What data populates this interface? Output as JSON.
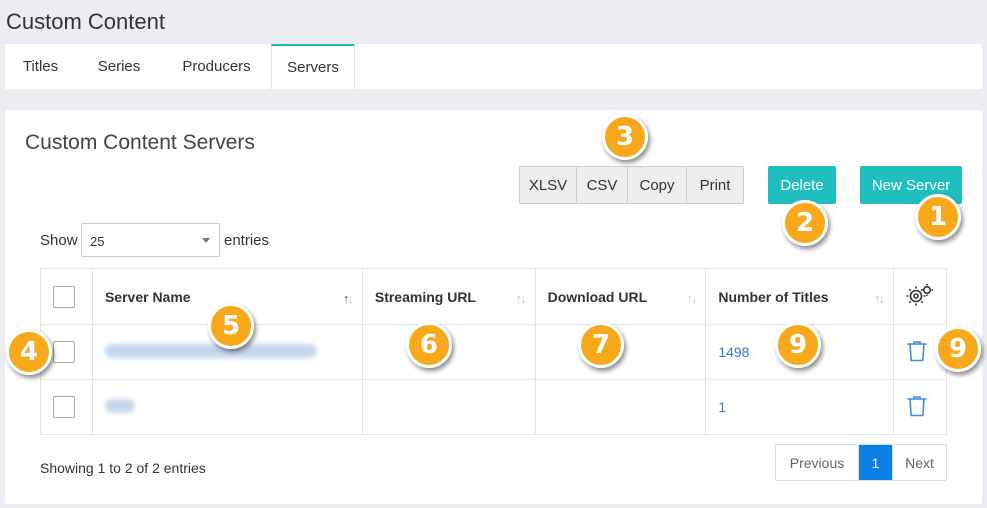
{
  "page_title": "Custom Content",
  "tabs": [
    {
      "label": "Titles"
    },
    {
      "label": "Series"
    },
    {
      "label": "Producers"
    },
    {
      "label": "Servers"
    }
  ],
  "panel": {
    "title": "Custom Content Servers",
    "export_buttons": {
      "xlsv": "XLSV",
      "csv": "CSV",
      "copy": "Copy",
      "print": "Print"
    },
    "delete_label": "Delete",
    "new_server_label": "New Server"
  },
  "length": {
    "show_label": "Show",
    "value": "25",
    "entries_label": "entries"
  },
  "table": {
    "headers": {
      "server_name": "Server Name",
      "streaming_url": "Streaming URL",
      "download_url": "Download URL",
      "number_of_titles": "Number of Titles"
    },
    "rows": [
      {
        "server_name": "",
        "streaming_url": "",
        "download_url": "",
        "number_of_titles": "1498"
      },
      {
        "server_name": "",
        "streaming_url": "",
        "download_url": "",
        "number_of_titles": "1"
      }
    ]
  },
  "info_text": "Showing 1 to 2 of 2 entries",
  "pagination": {
    "previous": "Previous",
    "current": "1",
    "next": "Next"
  },
  "callouts": {
    "c1": "1",
    "c2": "2",
    "c3": "3",
    "c4": "4",
    "c5": "5",
    "c6": "6",
    "c7": "7",
    "c9a": "9",
    "c9b": "9"
  },
  "colors": {
    "accent": "#1fbfbf",
    "badge": "#f7a81b",
    "link": "#3b79b3",
    "page_active": "#0b7fe6"
  }
}
